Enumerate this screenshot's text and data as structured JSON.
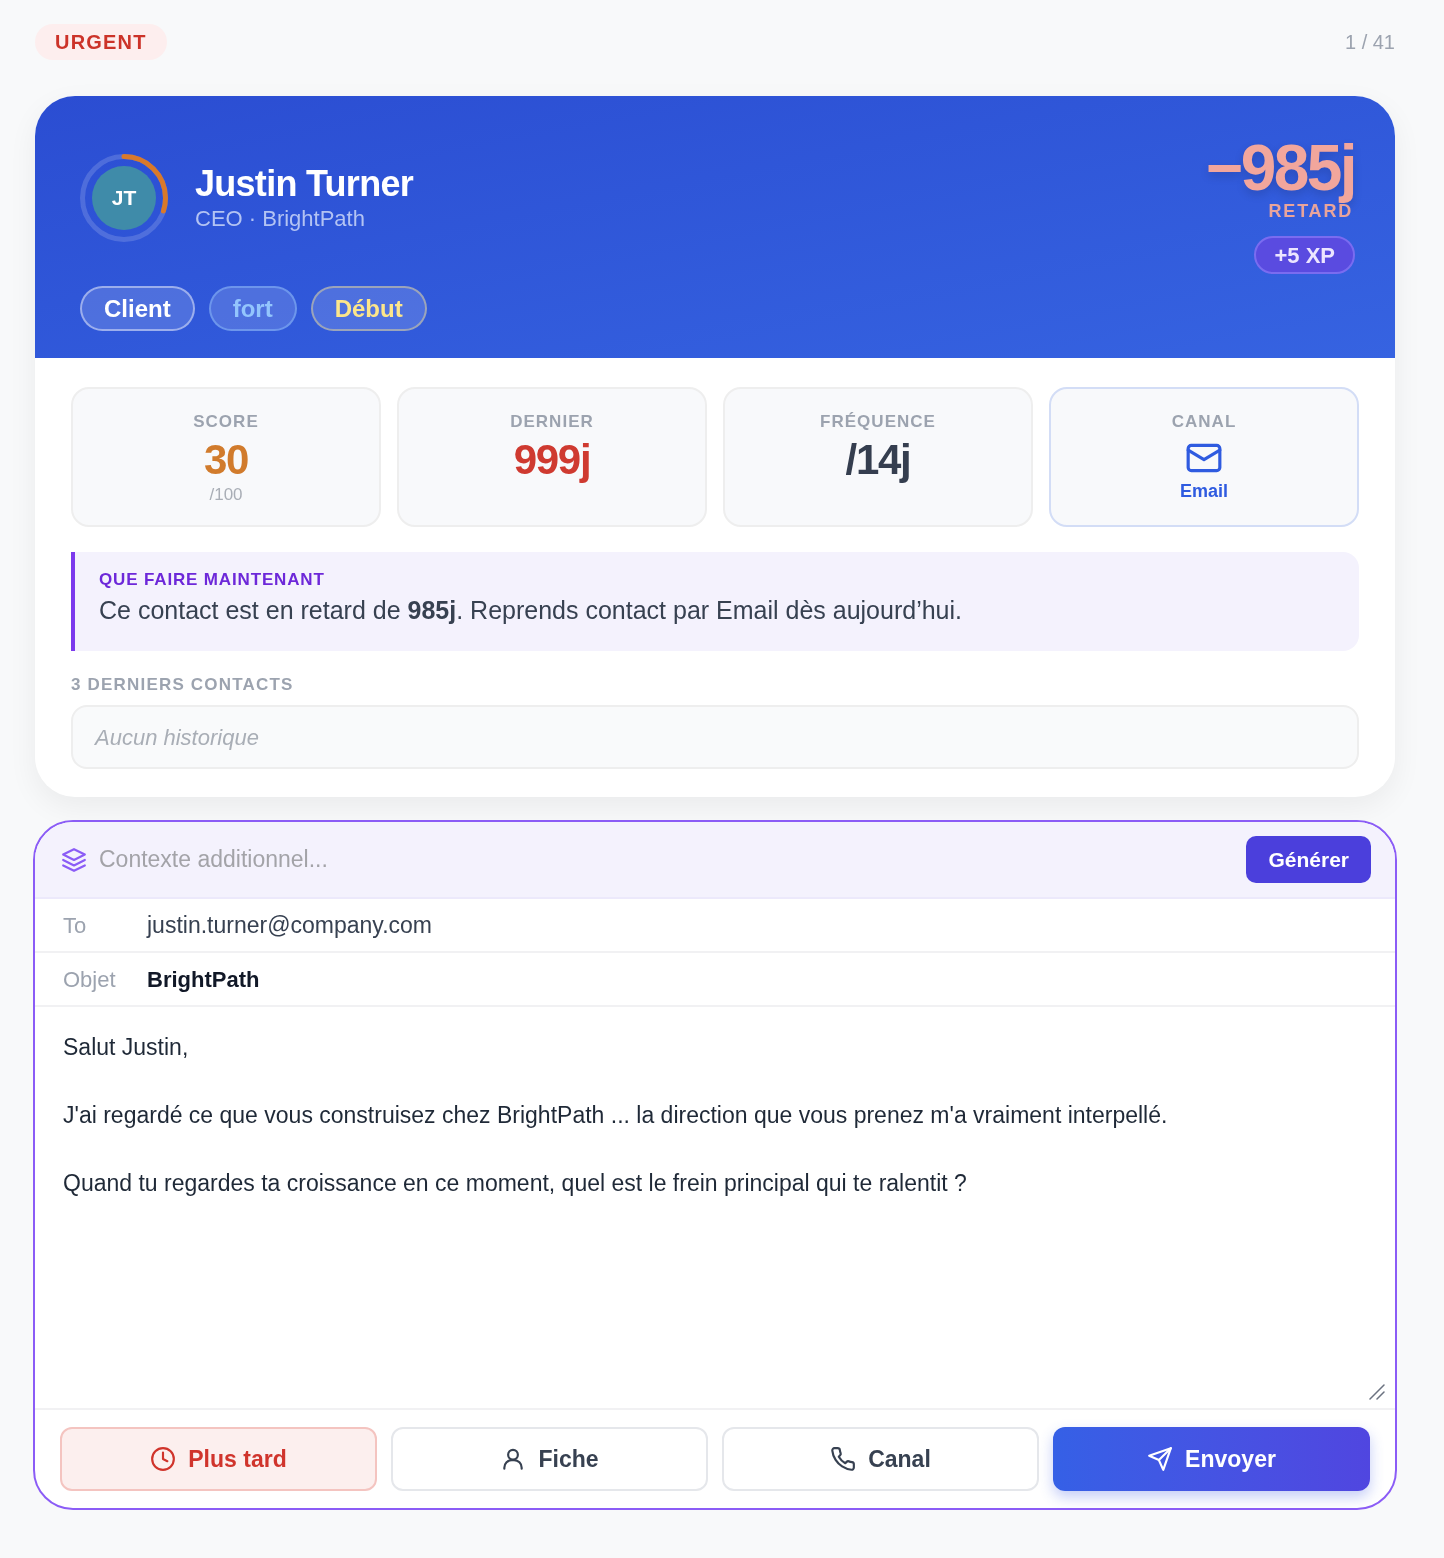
{
  "top_bar": {
    "badge": "URGENT",
    "counter": "1 / 41"
  },
  "contact": {
    "initials": "JT",
    "score_ring": {
      "level": 0.3
    },
    "name": "Justin Turner",
    "subtitle": "CEO · BrightPath",
    "tags": [
      {
        "label": "Client",
        "color": "#ffffff"
      },
      {
        "label": "fort",
        "color": "#93c5fd"
      },
      {
        "label": "Début",
        "color": "#fde68a"
      }
    ],
    "delay": {
      "value": "−985j",
      "label": "RETARD"
    },
    "xp_badge": "+5 XP"
  },
  "stats": [
    {
      "kind": "number",
      "label": "SCORE",
      "value": "30",
      "sub": "/100",
      "color": "#d17b2c"
    },
    {
      "kind": "number",
      "label": "DERNIER",
      "value": "999j",
      "color": "#cf3a30"
    },
    {
      "kind": "number",
      "label": "FRÉQUENCE",
      "value": "/14j",
      "color": "#353e4f"
    },
    {
      "kind": "channel",
      "label": "CANAL",
      "value": "Email",
      "color": "#2f5be0"
    }
  ],
  "advice": {
    "title": "QUE FAIRE MAINTENANT",
    "text": "Ce contact est en retard de **985j**. Reprends contact par Email dès aujourd’hui."
  },
  "history": {
    "title": "3 DERNIERS CONTACTS",
    "empty_text": "Aucun historique"
  },
  "composer": {
    "context": {
      "placeholder": "Contexte additionnel..."
    },
    "generate_button": "Générer",
    "fields": [
      {
        "kind": "recipient",
        "label": "To",
        "value": "justin.turner@company.com"
      },
      {
        "kind": "subject",
        "label": "Objet",
        "value": "BrightPath"
      }
    ],
    "body": "Salut Justin,\n\nJ'ai regardé ce que vous construisez chez BrightPath ... la direction que vous prenez m'a vraiment interpellé.\n\nQuand tu regardes ta croissance en ce moment, quel est le frein principal qui te ralentit ?"
  },
  "actions": [
    {
      "kind": "later",
      "label": "Plus tard"
    },
    {
      "kind": "profile",
      "label": "Fiche"
    },
    {
      "kind": "call",
      "label": "Canal"
    },
    {
      "kind": "send",
      "label": "Envoyer"
    }
  ]
}
